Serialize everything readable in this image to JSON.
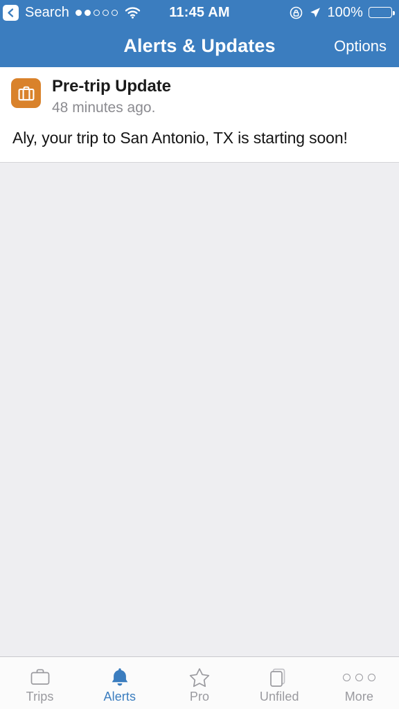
{
  "status_bar": {
    "back_icon": "chevron-left-icon",
    "carrier": "Search",
    "signal_bars_filled": 2,
    "signal_bars_total": 5,
    "wifi_icon": "wifi-icon",
    "time": "11:45 AM",
    "rotation_lock_icon": "rotation-lock-icon",
    "location_icon": "location-arrow-icon",
    "battery_percent": "100%",
    "battery_level": 100
  },
  "nav_bar": {
    "title": "Alerts & Updates",
    "action_label": "Options",
    "background_color": "#3b7dbf",
    "text_color": "#ffffff"
  },
  "alert": {
    "icon": "briefcase-icon",
    "icon_background_color": "#d9822b",
    "title": "Pre-trip Update",
    "timestamp": "48 minutes ago.",
    "message": "Aly, your trip to San Antonio, TX is starting soon!"
  },
  "content": {
    "background_color": "#eeeef1"
  },
  "tab_bar": {
    "active_color": "#3b7dbf",
    "inactive_color": "#9a9a9f",
    "items": [
      {
        "label": "Trips",
        "icon": "briefcase-outline-icon",
        "active": false
      },
      {
        "label": "Alerts",
        "icon": "bell-filled-icon",
        "active": true
      },
      {
        "label": "Pro",
        "icon": "star-outline-icon",
        "active": false
      },
      {
        "label": "Unfiled",
        "icon": "stacked-pages-icon",
        "active": false
      },
      {
        "label": "More",
        "icon": "ellipsis-icon",
        "active": false
      }
    ]
  }
}
